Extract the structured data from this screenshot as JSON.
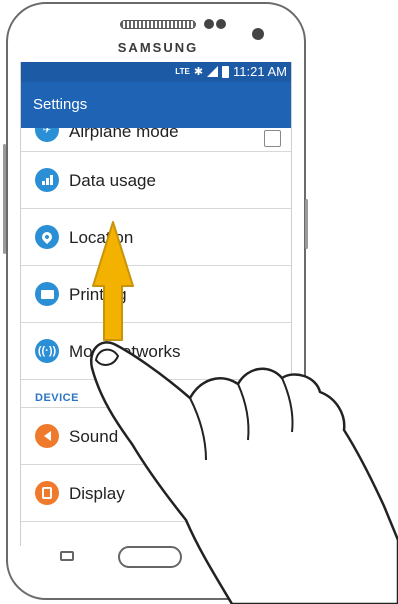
{
  "device": {
    "brand": "SAMSUNG"
  },
  "status_bar": {
    "network": "LTE",
    "time": "11:21 AM",
    "bt_icon": "bluetooth-icon",
    "signal_icon": "signal-icon",
    "battery_icon": "battery-icon"
  },
  "app_bar": {
    "title": "Settings"
  },
  "settings": {
    "items": [
      {
        "label": "Airplane mode",
        "icon": "airplane-icon",
        "has_checkbox": true
      },
      {
        "label": "Data usage",
        "icon": "data-usage-icon"
      },
      {
        "label": "Location",
        "icon": "location-pin-icon"
      },
      {
        "label": "Printing",
        "icon": "printer-icon"
      },
      {
        "label": "More networks",
        "icon": "antenna-icon"
      }
    ],
    "device_header": "DEVICE",
    "device_items": [
      {
        "label": "Sound",
        "icon": "speaker-icon"
      },
      {
        "label": "Display",
        "icon": "display-icon"
      }
    ]
  },
  "gesture": {
    "direction": "swipe-up",
    "arrow_color": "#f3b100",
    "arrow_stroke": "#c9930a"
  },
  "colors": {
    "status_bar": "#1c5aa6",
    "app_bar": "#1f63b5",
    "icon_blue": "#2b8fd6",
    "icon_orange": "#ef7a2c",
    "section_header": "#2b74c8"
  }
}
